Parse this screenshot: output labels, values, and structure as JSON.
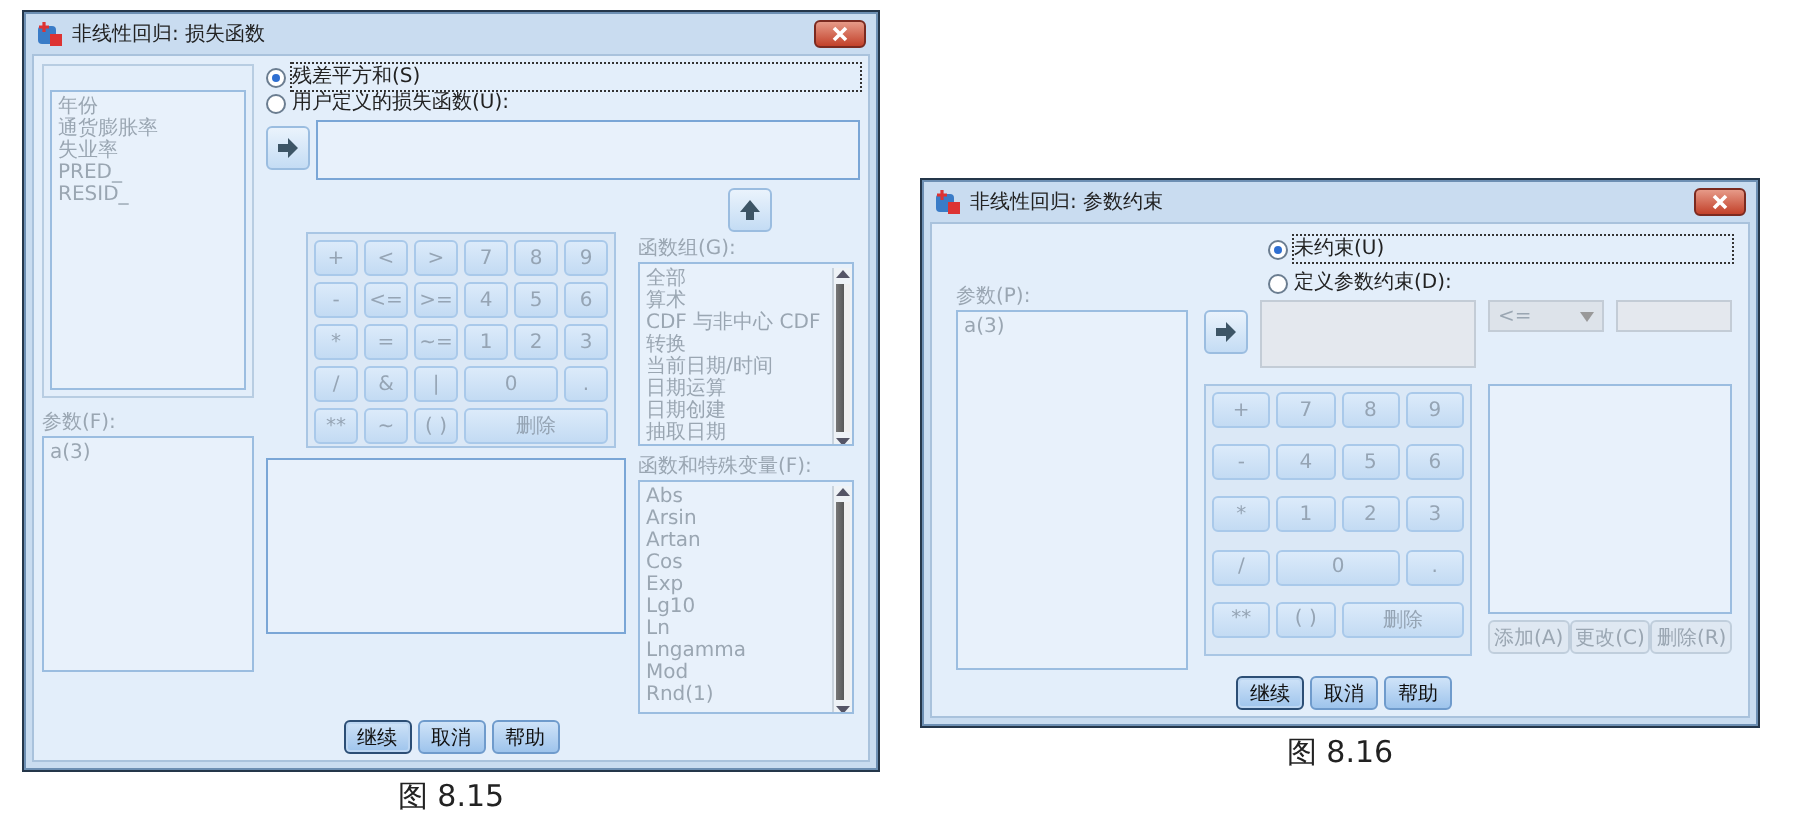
{
  "loss_dialog": {
    "title": "非线性回归: 损失函数",
    "variables": {
      "disabled": true,
      "items": [
        "年份",
        "通货膨胀率",
        "失业率",
        "PRED_",
        "RESID_"
      ]
    },
    "parameters": {
      "label": "参数(F):",
      "disabled": true,
      "items": [
        "a(3)"
      ]
    },
    "options": [
      {
        "label": "残差平方和(S)",
        "selected": true
      },
      {
        "label": "用户定义的损失函数(U):",
        "selected": false
      }
    ],
    "keypad": {
      "disabled": true,
      "keys": [
        {
          "label": "+",
          "kind": "key"
        },
        {
          "label": "<",
          "kind": "key"
        },
        {
          "label": ">",
          "kind": "key"
        },
        {
          "label": "7",
          "kind": "key"
        },
        {
          "label": "8",
          "kind": "key"
        },
        {
          "label": "9",
          "kind": "key"
        },
        {
          "label": "-",
          "kind": "key"
        },
        {
          "label": "<=",
          "kind": "key"
        },
        {
          "label": ">=",
          "kind": "key"
        },
        {
          "label": "4",
          "kind": "key"
        },
        {
          "label": "5",
          "kind": "key"
        },
        {
          "label": "6",
          "kind": "key"
        },
        {
          "label": "*",
          "kind": "key"
        },
        {
          "label": "=",
          "kind": "key"
        },
        {
          "label": "~=",
          "kind": "key"
        },
        {
          "label": "1",
          "kind": "key"
        },
        {
          "label": "2",
          "kind": "key"
        },
        {
          "label": "3",
          "kind": "key"
        },
        {
          "label": "/",
          "kind": "key"
        },
        {
          "label": "&",
          "kind": "key"
        },
        {
          "label": "|",
          "kind": "key"
        },
        {
          "label": "0",
          "kind": "wide"
        },
        {
          "label": ".",
          "kind": "key"
        },
        {
          "label": "**",
          "kind": "key"
        },
        {
          "label": "~",
          "kind": "key"
        },
        {
          "label": "( )",
          "kind": "key"
        },
        {
          "label": "删除",
          "kind": "wider"
        }
      ]
    },
    "function_group": {
      "label": "函数组(G):",
      "disabled": true,
      "items": [
        "全部",
        "算术",
        "CDF 与非中心 CDF",
        "转换",
        "当前日期/时间",
        "日期运算",
        "日期创建",
        "抽取日期"
      ]
    },
    "functions": {
      "label": "函数和特殊变量(F):",
      "disabled": true,
      "items": [
        "Abs",
        "Arsin",
        "Artan",
        "Cos",
        "Exp",
        "Lg10",
        "Ln",
        "Lngamma",
        "Mod",
        "Rnd(1)"
      ]
    },
    "buttons": [
      {
        "label": "继续",
        "default": true
      },
      {
        "label": "取消",
        "default": false
      },
      {
        "label": "帮助",
        "default": false
      }
    ],
    "caption": "图 8.15"
  },
  "constraint_dialog": {
    "title": "非线性回归: 参数约束",
    "parameters": {
      "label": "参数(P):",
      "disabled": true,
      "items": [
        "a(3)"
      ]
    },
    "options": [
      {
        "label": "未约束(U)",
        "selected": true
      },
      {
        "label": "定义参数约束(D):",
        "selected": false
      }
    ],
    "operator": {
      "value": "<=",
      "disabled": true
    },
    "keypad": {
      "disabled": true,
      "keys": [
        {
          "label": "+",
          "kind": "key"
        },
        {
          "label": "7",
          "kind": "key"
        },
        {
          "label": "8",
          "kind": "key"
        },
        {
          "label": "9",
          "kind": "key"
        },
        {
          "label": "-",
          "kind": "key"
        },
        {
          "label": "4",
          "kind": "key"
        },
        {
          "label": "5",
          "kind": "key"
        },
        {
          "label": "6",
          "kind": "key"
        },
        {
          "label": "*",
          "kind": "key"
        },
        {
          "label": "1",
          "kind": "key"
        },
        {
          "label": "2",
          "kind": "key"
        },
        {
          "label": "3",
          "kind": "key"
        },
        {
          "label": "/",
          "kind": "key"
        },
        {
          "label": "0",
          "kind": "wide"
        },
        {
          "label": ".",
          "kind": "key"
        },
        {
          "label": "**",
          "kind": "key"
        },
        {
          "label": "( )",
          "kind": "key"
        },
        {
          "label": "删除",
          "kind": "wide"
        }
      ]
    },
    "list_buttons": {
      "disabled": true,
      "items": [
        "添加(A)",
        "更改(C)",
        "删除(R)"
      ]
    },
    "buttons": [
      {
        "label": "继续",
        "default": true
      },
      {
        "label": "取消",
        "default": false
      },
      {
        "label": "帮助",
        "default": false
      }
    ],
    "caption": "图 8.16"
  }
}
